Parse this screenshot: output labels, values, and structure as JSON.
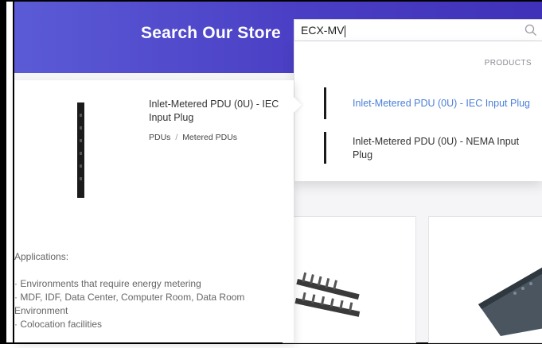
{
  "header": {
    "title": "Search Our Store"
  },
  "search": {
    "value": "ECX-MV",
    "icon": "search-icon"
  },
  "dropdown": {
    "section_label": "PRODUCTS",
    "items": [
      {
        "label": "Inlet-Metered PDU (0U) - IEC Input Plug",
        "active": true
      },
      {
        "label": "Inlet-Metered PDU (0U) - NEMA Input Plug",
        "active": false
      }
    ]
  },
  "preview": {
    "title": "Inlet-Metered PDU (0U) - IEC Input Plug",
    "category_parent": "PDUs",
    "category_separator": "/",
    "category_child": "Metered PDUs",
    "applications_heading": "Applications:",
    "applications": [
      "· Environments that require energy metering",
      "· MDF, IDF, Data Center, Computer Room, Data Room Environment",
      "· Colocation facilities"
    ]
  },
  "colors": {
    "header_start": "#5b5bd6",
    "header_end": "#3f32b8",
    "link_active": "#4a7fd8"
  }
}
